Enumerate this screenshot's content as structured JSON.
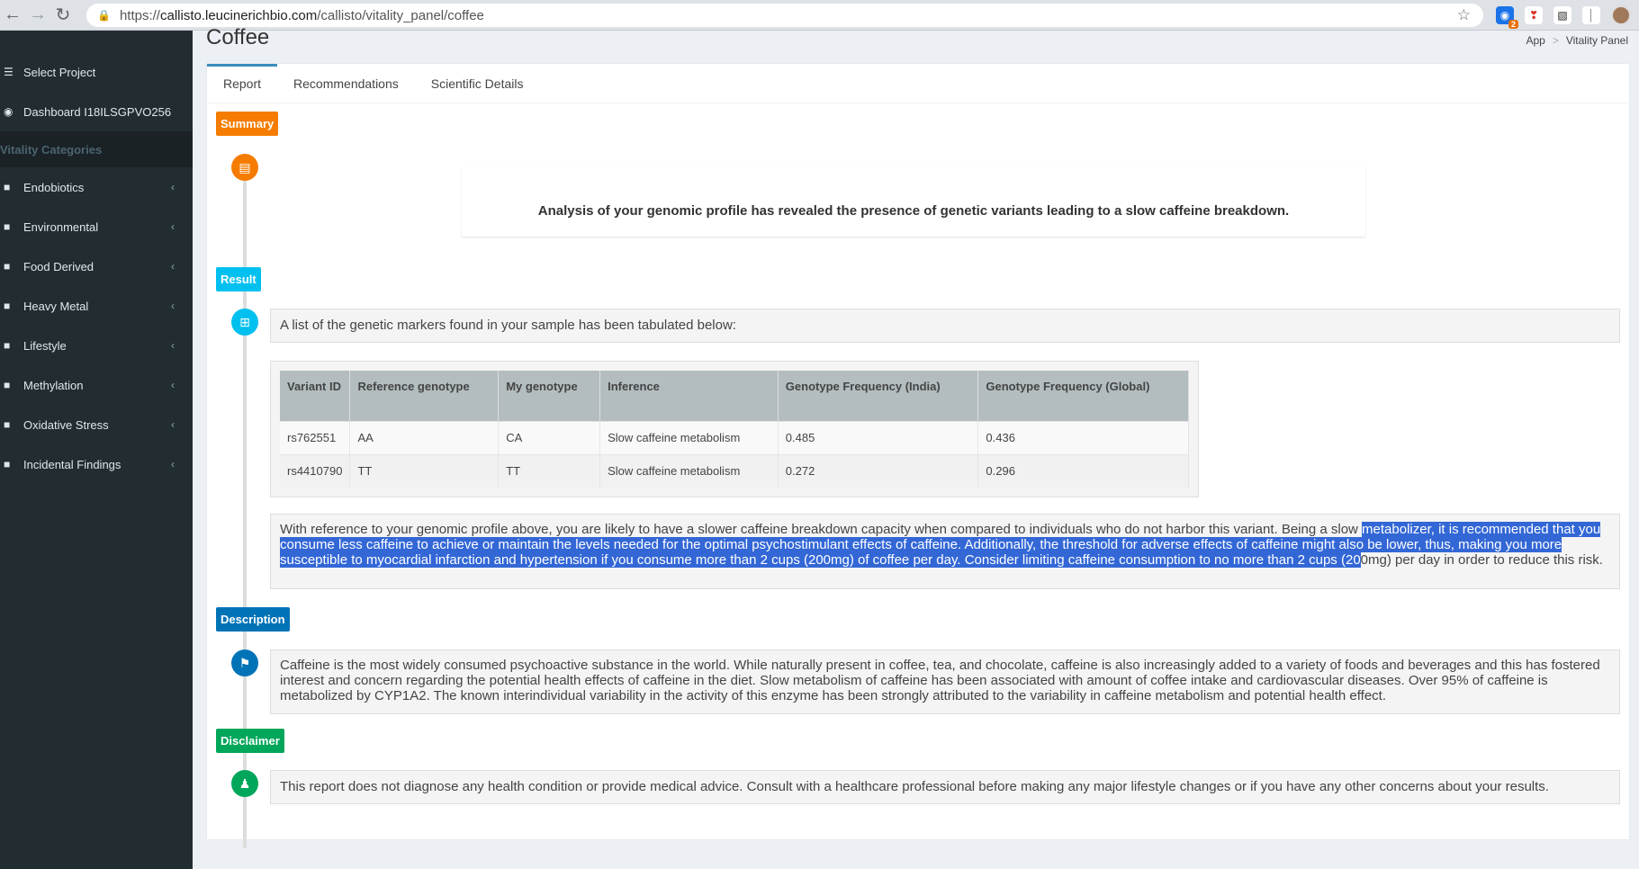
{
  "browser": {
    "url_scheme": "https://",
    "url_host": "callisto.leucinerichbio.com",
    "url_path": "/callisto/vitality_panel/coffee",
    "ext_badge": "2"
  },
  "sidebar": {
    "items": [
      {
        "label": "Select Project",
        "icon": "list-icon"
      },
      {
        "label": "Dashboard I18ILSGPVO256",
        "icon": "dashboard-icon"
      }
    ],
    "section": "Vitality Categories",
    "categories": [
      {
        "label": "Endobiotics"
      },
      {
        "label": "Environmental"
      },
      {
        "label": "Food Derived"
      },
      {
        "label": "Heavy Metal"
      },
      {
        "label": "Lifestyle"
      },
      {
        "label": "Methylation"
      },
      {
        "label": "Oxidative Stress"
      },
      {
        "label": "Incidental Findings"
      }
    ]
  },
  "page": {
    "title": "Coffee",
    "breadcrumb": [
      "App",
      "Vitality Panel"
    ]
  },
  "tabs": [
    "Report",
    "Recommendations",
    "Scientific Details"
  ],
  "colors": {
    "summary": "#f57c00",
    "result": "#00c0ef",
    "description": "#0073b7",
    "disclaimer": "#00a65a"
  },
  "timeline": {
    "summary_label": "Summary",
    "summary_text": "Analysis of your genomic profile has revealed the presence of genetic variants leading to a slow caffeine breakdown.",
    "result_label": "Result",
    "result_intro": "A list of the genetic markers found in your sample has been tabulated below:",
    "table": {
      "headers": [
        "Variant ID",
        "Reference genotype",
        "My genotype",
        "Inference",
        "Genotype Frequency (India)",
        "Genotype Frequency (Global)"
      ],
      "rows": [
        [
          "rs762551",
          "AA",
          "CA",
          "Slow caffeine metabolism",
          "0.485",
          "0.436"
        ],
        [
          "rs4410790",
          "TT",
          "TT",
          "Slow caffeine metabolism",
          "0.272",
          "0.296"
        ]
      ]
    },
    "result_text_a": "With reference to your genomic profile above, you are likely to have a slower caffeine breakdown capacity when compared to individuals who do not harbor this variant. Being a slow ",
    "result_text_highlight": "metabolizer, it is recommended that you consume less caffeine to achieve or maintain the levels needed for the optimal psychostimulant effects of caffeine. Additionally, the threshold for adverse effects of caffeine might also be lower, thus, making you more susceptible to myocardial infarction and hypertension if you consume more than 2 cups (200mg) of coffee per day. Consider limiting caffeine consumption to no more than 2 cups (20",
    "result_text_b": "0mg) per day in order to reduce this risk.",
    "description_label": "Description",
    "description_text": "Caffeine is the most widely consumed psychoactive substance in the world. While naturally present in coffee, tea, and chocolate, caffeine is also increasingly added to a variety of foods and beverages and this has fostered interest and concern regarding the potential health effects of caffeine in the diet. Slow metabolism of caffeine has been associated with amount of coffee intake and cardiovascular diseases. Over 95% of caffeine is metabolized by CYP1A2. The known interindividual variability in the activity of this enzyme has been strongly attributed to the variability in caffeine metabolism and potential health effect.",
    "disclaimer_label": "Disclaimer",
    "disclaimer_text": "This report does not diagnose any health condition or provide medical advice. Consult with a healthcare professional before making any major lifestyle changes or if you have any other concerns about your results."
  }
}
